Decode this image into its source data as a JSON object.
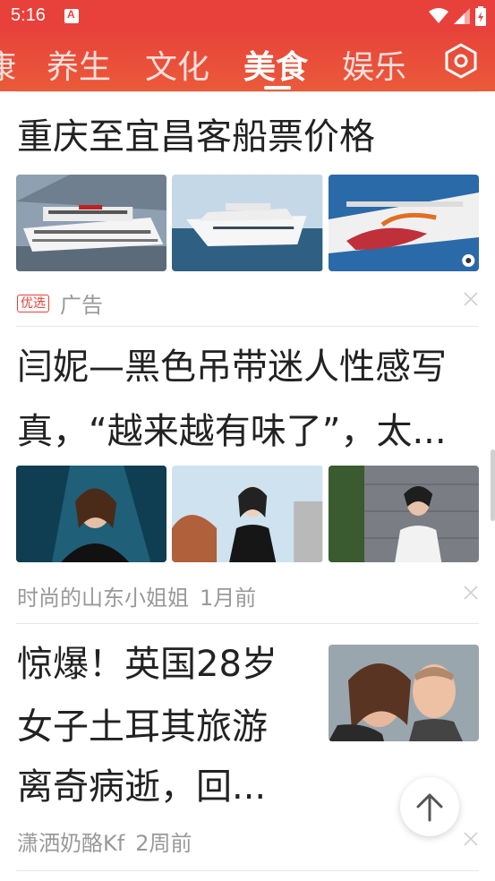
{
  "status_bar": {
    "time": "5:16"
  },
  "nav": {
    "tabs": [
      {
        "label": "康",
        "active": false
      },
      {
        "label": "养生",
        "active": false
      },
      {
        "label": "文化",
        "active": false
      },
      {
        "label": "美食",
        "active": true
      },
      {
        "label": "娱乐",
        "active": false
      }
    ],
    "settings_icon": "hexagon-settings-icon"
  },
  "colors": {
    "brand": "#e8403a",
    "text_primary": "#222222",
    "text_secondary": "#999999"
  },
  "feed": [
    {
      "title": "重庆至宜昌客船票价格",
      "images": [
        "cruise-ship-river",
        "white-yacht-sea",
        "norwegian-cruise-ship"
      ],
      "tag": "优选",
      "source": "广告",
      "time": ""
    },
    {
      "title_line1": "闫妮—黑色吊带迷人性感写",
      "title_line2": "真，“越来越有味了”，太...",
      "images": [
        "woman-black-dress-blue",
        "woman-black-top-city",
        "woman-white-top-wall"
      ],
      "source": "时尚的山东小姐姐",
      "time": "1月前"
    },
    {
      "title_line1": "惊爆！英国28岁",
      "title_line2": "女子土耳其旅游",
      "title_line3": "离奇病逝，回...",
      "images": [
        "couple-selfie"
      ],
      "source": "潇洒奶酪Kf",
      "time": "2周前"
    }
  ]
}
